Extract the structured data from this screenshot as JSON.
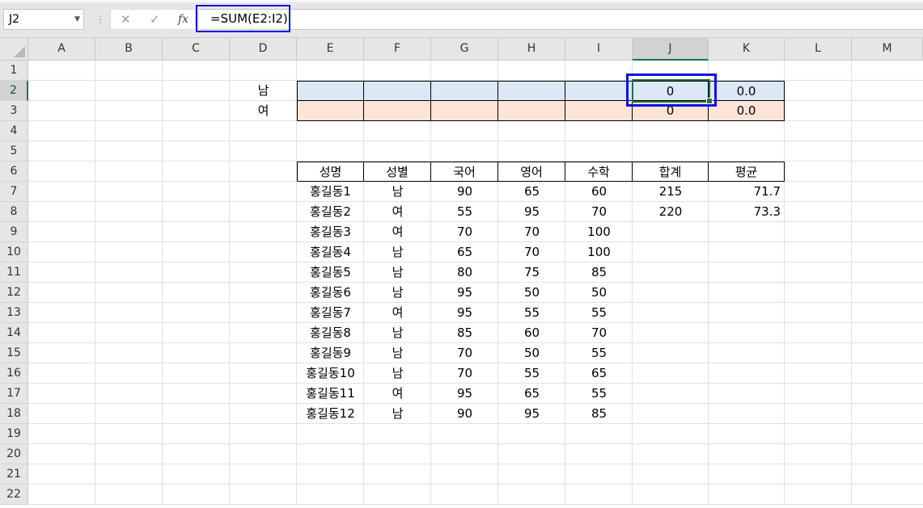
{
  "formula_bar": {
    "name_box": "J2",
    "cancel_symbol": "✕",
    "enter_symbol": "✓",
    "fx_label": "fx",
    "formula": "=SUM(E2:I2)"
  },
  "columns": [
    "A",
    "B",
    "C",
    "D",
    "E",
    "F",
    "G",
    "H",
    "I",
    "J",
    "K",
    "L",
    "M"
  ],
  "selected_column": "J",
  "rows": [
    "1",
    "2",
    "3",
    "4",
    "5",
    "6",
    "7",
    "8",
    "9",
    "10",
    "11",
    "12",
    "13",
    "14",
    "15",
    "16",
    "17",
    "18",
    "19",
    "20",
    "21",
    "22"
  ],
  "selected_row": "2",
  "summary": {
    "male": {
      "label": "남",
      "total": "0",
      "average": "0.0",
      "fill": "#dde8f6"
    },
    "female": {
      "label": "여",
      "total": "0",
      "average": "0.0",
      "fill": "#fde3d8"
    }
  },
  "table": {
    "headers": [
      "성명",
      "성별",
      "국어",
      "영어",
      "수학",
      "합계",
      "평균"
    ],
    "rows": [
      {
        "name": "홍길동1",
        "gender": "남",
        "korean": "90",
        "english": "65",
        "math": "60",
        "total": "215",
        "avg": "71.7"
      },
      {
        "name": "홍길동2",
        "gender": "여",
        "korean": "55",
        "english": "95",
        "math": "70",
        "total": "220",
        "avg": "73.3"
      },
      {
        "name": "홍길동3",
        "gender": "여",
        "korean": "70",
        "english": "70",
        "math": "100",
        "total": "",
        "avg": ""
      },
      {
        "name": "홍길동4",
        "gender": "남",
        "korean": "65",
        "english": "70",
        "math": "100",
        "total": "",
        "avg": ""
      },
      {
        "name": "홍길동5",
        "gender": "남",
        "korean": "80",
        "english": "75",
        "math": "85",
        "total": "",
        "avg": ""
      },
      {
        "name": "홍길동6",
        "gender": "남",
        "korean": "95",
        "english": "50",
        "math": "50",
        "total": "",
        "avg": ""
      },
      {
        "name": "홍길동7",
        "gender": "여",
        "korean": "95",
        "english": "55",
        "math": "55",
        "total": "",
        "avg": ""
      },
      {
        "name": "홍길동8",
        "gender": "남",
        "korean": "85",
        "english": "60",
        "math": "70",
        "total": "",
        "avg": ""
      },
      {
        "name": "홍길동9",
        "gender": "남",
        "korean": "70",
        "english": "50",
        "math": "55",
        "total": "",
        "avg": ""
      },
      {
        "name": "홍길동10",
        "gender": "남",
        "korean": "70",
        "english": "55",
        "math": "65",
        "total": "",
        "avg": ""
      },
      {
        "name": "홍길동11",
        "gender": "여",
        "korean": "95",
        "english": "65",
        "math": "55",
        "total": "",
        "avg": ""
      },
      {
        "name": "홍길동12",
        "gender": "남",
        "korean": "90",
        "english": "95",
        "math": "85",
        "total": "",
        "avg": ""
      }
    ]
  },
  "colors": {
    "selection": "#217346",
    "highlight_box": "#1010e0"
  }
}
